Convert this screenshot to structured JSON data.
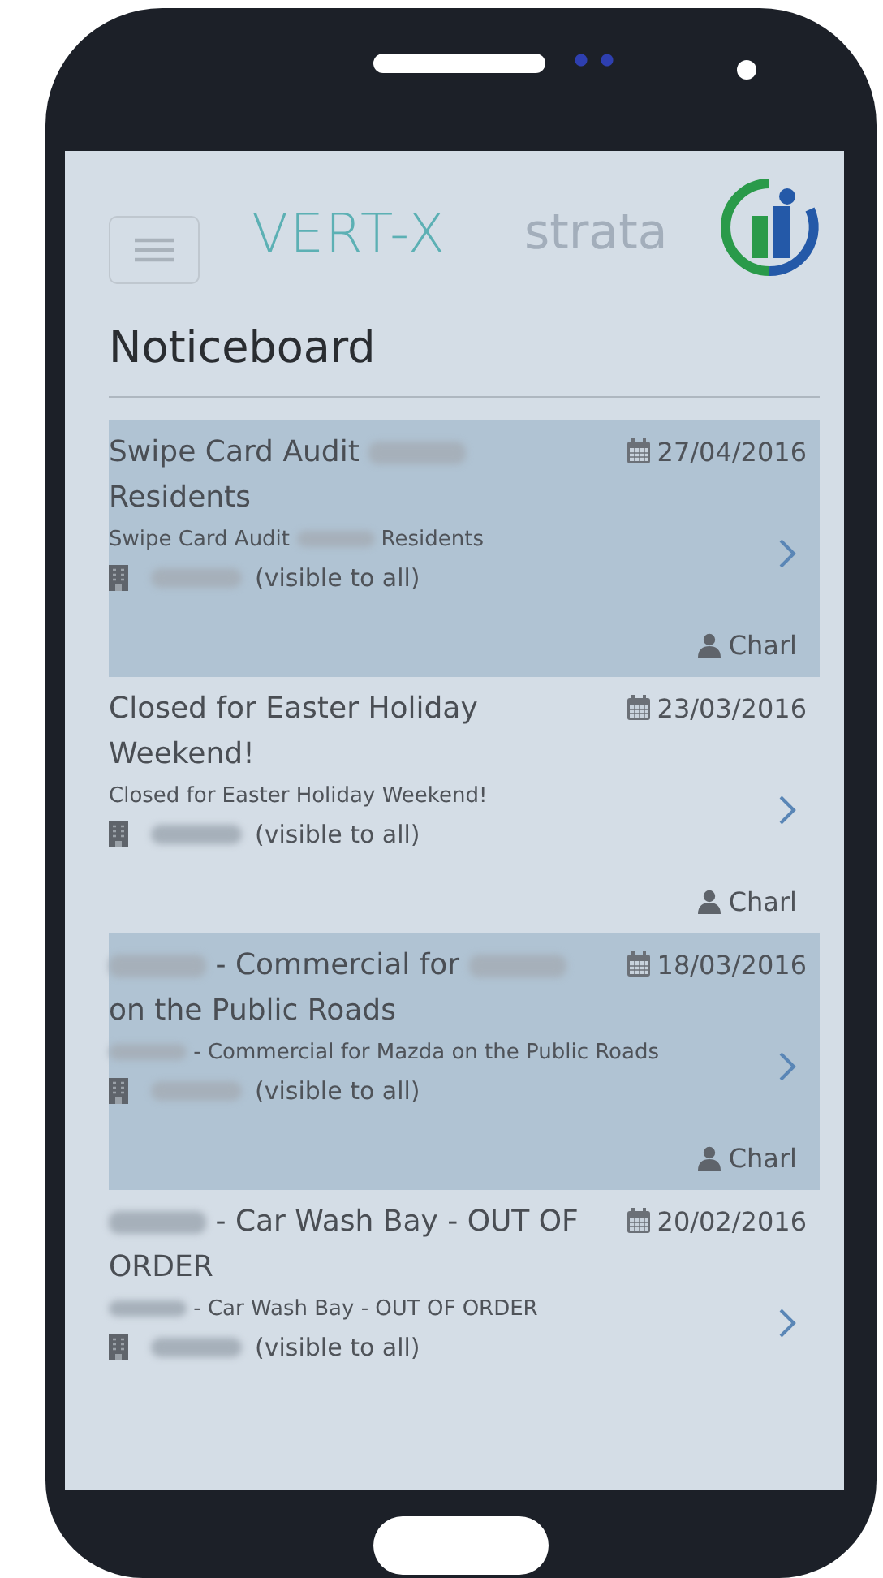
{
  "header": {
    "brand": "VERT-X",
    "faint_logo": "strata"
  },
  "page_title": "Noticeboard",
  "notices": [
    {
      "shaded": true,
      "title": [
        {
          "kind": "text",
          "text": "Swipe Card Audit"
        },
        {
          "kind": "blurred"
        },
        {
          "kind": "text",
          "text": "Residents"
        }
      ],
      "date": "27/04/2016",
      "summary": [
        {
          "kind": "text",
          "text": "Swipe Card Audit"
        },
        {
          "kind": "blurred"
        },
        {
          "kind": "text",
          "text": "Residents"
        }
      ],
      "audience": "(visible to all)",
      "author": "Charl"
    },
    {
      "shaded": false,
      "title": [
        {
          "kind": "text",
          "text": "Closed for Easter Holiday Weekend!"
        }
      ],
      "date": "23/03/2016",
      "summary": [
        {
          "kind": "text",
          "text": "Closed for Easter Holiday Weekend!"
        }
      ],
      "audience": "(visible to all)",
      "author": "Charl"
    },
    {
      "shaded": true,
      "title": [
        {
          "kind": "blurred"
        },
        {
          "kind": "text",
          "text": "- Commercial for"
        },
        {
          "kind": "blurred"
        },
        {
          "kind": "text",
          "text": "on the Public Roads"
        }
      ],
      "date": "18/03/2016",
      "summary": [
        {
          "kind": "blurred"
        },
        {
          "kind": "text",
          "text": "- Commercial for Mazda on the Public Roads"
        }
      ],
      "audience": "(visible to all)",
      "author": "Charl"
    },
    {
      "shaded": false,
      "title": [
        {
          "kind": "blurred"
        },
        {
          "kind": "text",
          "text": "- Car Wash Bay - OUT OF ORDER"
        }
      ],
      "date": "20/02/2016",
      "summary": [
        {
          "kind": "blurred"
        },
        {
          "kind": "text",
          "text": "- Car Wash Bay - OUT OF ORDER"
        }
      ],
      "audience": "(visible to all)"
    }
  ]
}
